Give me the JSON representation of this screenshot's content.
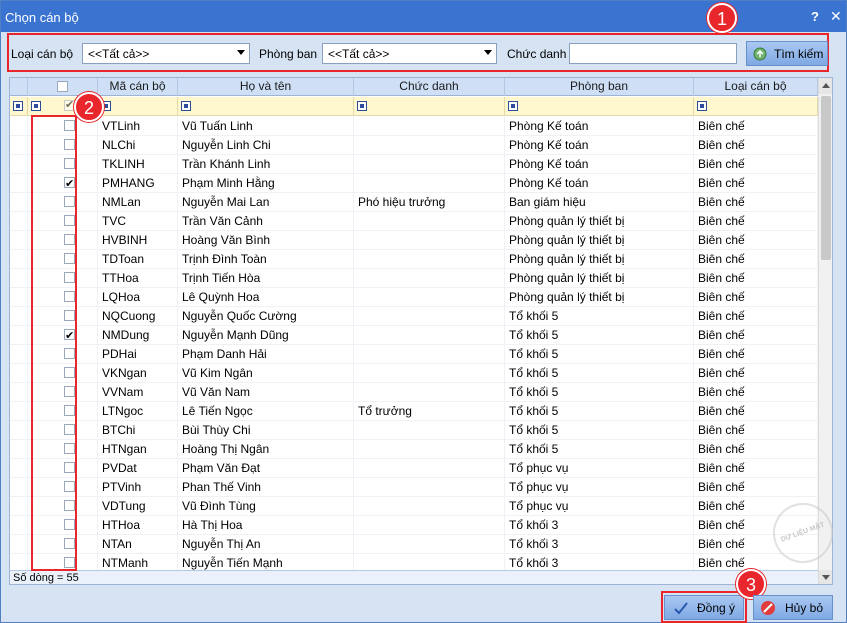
{
  "window": {
    "title": "Chọn cán bộ",
    "help_label": "?",
    "close_label": "✕"
  },
  "filters": {
    "loai_can_bo_label": "Loại cán bộ",
    "loai_can_bo_value": "<<Tất cả>>",
    "phong_ban_label": "Phòng ban",
    "phong_ban_value": "<<Tất cả>>",
    "chuc_danh_label": "Chức danh",
    "chuc_danh_value": "",
    "search_label": "Tìm kiếm"
  },
  "callouts": [
    "1",
    "2",
    "3"
  ],
  "grid": {
    "columns": [
      "",
      "Mã cán bộ",
      "Họ và tên",
      "Chức danh",
      "Phòng ban",
      "Loại cán bộ"
    ],
    "rows": [
      {
        "checked": false,
        "ma": "VTLinh",
        "ten": "Vũ Tuấn Linh",
        "chuc": "",
        "phong": "Phòng Kế toán",
        "loai": "Biên chế"
      },
      {
        "checked": false,
        "ma": "NLChi",
        "ten": "Nguyễn Linh Chi",
        "chuc": "",
        "phong": "Phòng Kế toán",
        "loai": "Biên chế"
      },
      {
        "checked": false,
        "ma": "TKLINH",
        "ten": "Trần Khánh Linh",
        "chuc": "",
        "phong": "Phòng Kế toán",
        "loai": "Biên chế"
      },
      {
        "checked": true,
        "ma": "PMHANG",
        "ten": "Phạm Minh Hằng",
        "chuc": "",
        "phong": "Phòng Kế toán",
        "loai": "Biên chế"
      },
      {
        "checked": false,
        "ma": "NMLan",
        "ten": "Nguyễn Mai Lan",
        "chuc": "Phó hiệu trưởng",
        "phong": "Ban giám hiệu",
        "loai": "Biên chế"
      },
      {
        "checked": false,
        "ma": "TVC",
        "ten": "Trần Văn Cảnh",
        "chuc": "",
        "phong": "Phòng quản lý thiết bị",
        "loai": "Biên chế"
      },
      {
        "checked": false,
        "ma": "HVBINH",
        "ten": "Hoàng Văn Bình",
        "chuc": "",
        "phong": "Phòng quản lý thiết bị",
        "loai": "Biên chế"
      },
      {
        "checked": false,
        "ma": "TDToan",
        "ten": "Trịnh Đình Toàn",
        "chuc": "",
        "phong": "Phòng quản lý thiết bị",
        "loai": "Biên chế"
      },
      {
        "checked": false,
        "ma": "TTHoa",
        "ten": "Trịnh Tiến Hòa",
        "chuc": "",
        "phong": "Phòng quản lý thiết bị",
        "loai": "Biên chế"
      },
      {
        "checked": false,
        "ma": "LQHoa",
        "ten": "Lê Quỳnh Hoa",
        "chuc": "",
        "phong": "Phòng quản lý thiết bị",
        "loai": "Biên chế"
      },
      {
        "checked": false,
        "ma": "NQCuong",
        "ten": "Nguyễn Quốc Cường",
        "chuc": "",
        "phong": "Tổ khối 5",
        "loai": "Biên chế"
      },
      {
        "checked": true,
        "ma": "NMDung",
        "ten": "Nguyễn Mạnh Dũng",
        "chuc": "",
        "phong": "Tổ khối 5",
        "loai": "Biên chế"
      },
      {
        "checked": false,
        "ma": "PDHai",
        "ten": "Phạm Danh Hải",
        "chuc": "",
        "phong": "Tổ khối 5",
        "loai": "Biên chế"
      },
      {
        "checked": false,
        "ma": "VKNgan",
        "ten": "Vũ Kim Ngân",
        "chuc": "",
        "phong": "Tổ khối 5",
        "loai": "Biên chế"
      },
      {
        "checked": false,
        "ma": "VVNam",
        "ten": "Vũ Văn Nam",
        "chuc": "",
        "phong": "Tổ khối 5",
        "loai": "Biên chế"
      },
      {
        "checked": false,
        "ma": "LTNgoc",
        "ten": "Lê Tiến Ngọc",
        "chuc": "Tổ trưởng",
        "phong": "Tổ khối 5",
        "loai": "Biên chế"
      },
      {
        "checked": false,
        "ma": "BTChi",
        "ten": "Bùi Thùy Chi",
        "chuc": "",
        "phong": "Tổ khối 5",
        "loai": "Biên chế"
      },
      {
        "checked": false,
        "ma": "HTNgan",
        "ten": "Hoàng Thị Ngân",
        "chuc": "",
        "phong": "Tổ khối 5",
        "loai": "Biên chế"
      },
      {
        "checked": false,
        "ma": "PVDat",
        "ten": "Phạm Văn Đạt",
        "chuc": "",
        "phong": "Tổ phục vụ",
        "loai": "Biên chế"
      },
      {
        "checked": false,
        "ma": "PTVinh",
        "ten": "Phan Thế Vinh",
        "chuc": "",
        "phong": "Tổ phục vụ",
        "loai": "Biên chế"
      },
      {
        "checked": false,
        "ma": "VDTung",
        "ten": "Vũ Đình Tùng",
        "chuc": "",
        "phong": "Tổ phục vụ",
        "loai": "Biên chế"
      },
      {
        "checked": false,
        "ma": "HTHoa",
        "ten": "Hà Thị Hoa",
        "chuc": "",
        "phong": "Tổ khối 3",
        "loai": "Biên chế"
      },
      {
        "checked": false,
        "ma": "NTAn",
        "ten": "Nguyễn Thị An",
        "chuc": "",
        "phong": "Tổ khối 3",
        "loai": "Biên chế"
      },
      {
        "checked": false,
        "ma": "NTManh",
        "ten": "Nguyễn Tiến Mạnh",
        "chuc": "",
        "phong": "Tổ khối 3",
        "loai": "Biên chế"
      }
    ],
    "status": "Số dòng = 55"
  },
  "buttons": {
    "ok_label": "Đồng ý",
    "cancel_label": "Hủy bỏ"
  },
  "colors": {
    "accent": "#3b73d0",
    "callout": "#e8262b"
  },
  "icons": {
    "search": "search-icon",
    "ok": "check-icon",
    "cancel": "cancel-icon"
  }
}
